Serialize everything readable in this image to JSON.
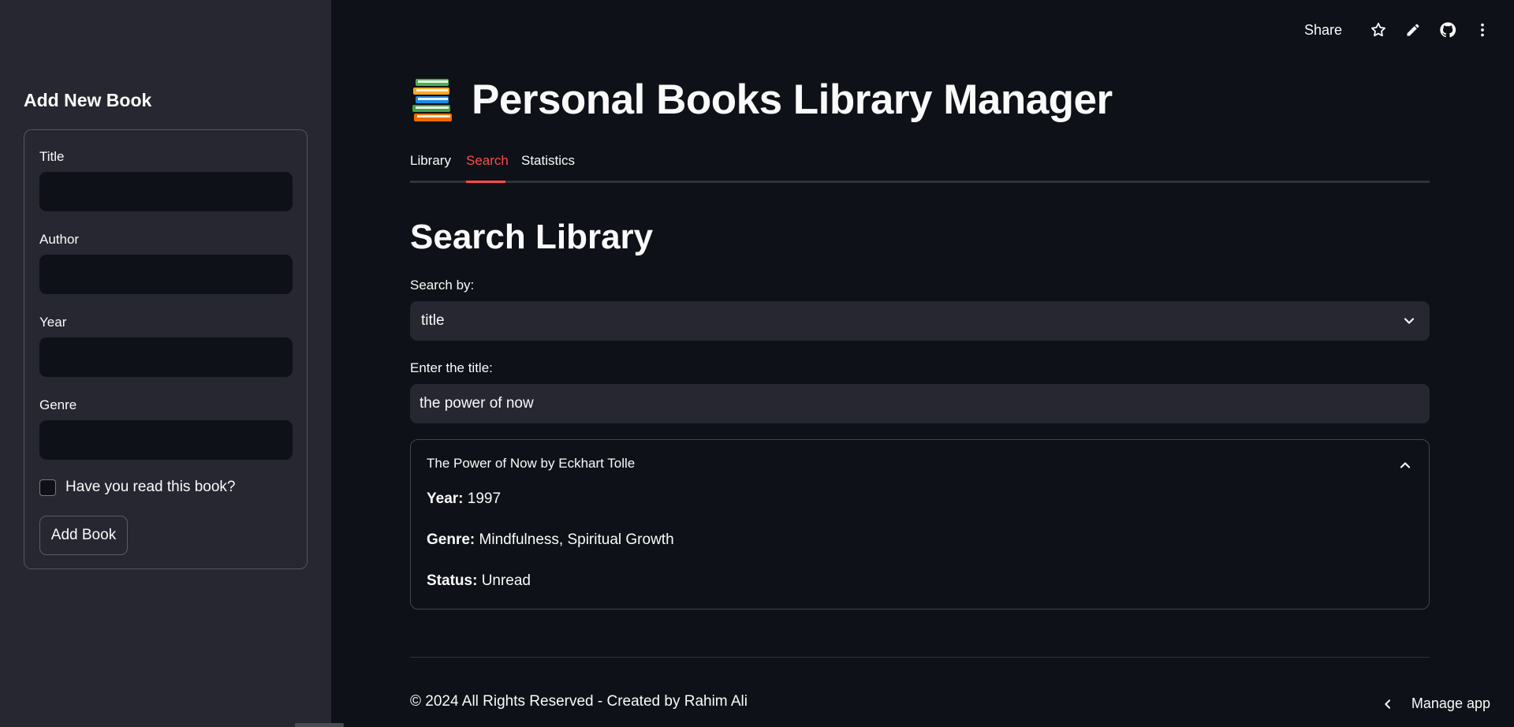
{
  "sidebar": {
    "title": "Add New Book",
    "fields": [
      {
        "label": "Title",
        "value": ""
      },
      {
        "label": "Author",
        "value": ""
      },
      {
        "label": "Year",
        "value": ""
      },
      {
        "label": "Genre",
        "value": ""
      }
    ],
    "read_checkbox": {
      "label": "Have you read this book?",
      "checked": false
    },
    "add_button": "Add Book"
  },
  "toolbar": {
    "share": "Share",
    "icons": [
      "star-icon",
      "pencil-icon",
      "github-icon",
      "more-vertical-icon"
    ]
  },
  "main": {
    "title": "Personal Books Library Manager",
    "title_icon": "books-icon",
    "tabs": [
      {
        "label": "Library",
        "active": false
      },
      {
        "label": "Search",
        "active": true
      },
      {
        "label": "Statistics",
        "active": false
      }
    ],
    "section_title": "Search Library",
    "search_by_label": "Search by:",
    "search_by_value": "title",
    "query_label": "Enter the title:",
    "query_value": "the power of now",
    "result": {
      "header": "The Power of Now by Eckhart Tolle",
      "year_label": "Year:",
      "year": "1997",
      "genre_label": "Genre:",
      "genre": "Mindfulness, Spiritual Growth",
      "status_label": "Status:",
      "status": "Unread"
    },
    "footer": "© 2024 All Rights Reserved - Created by Rahim Ali"
  },
  "manage_app": "Manage app",
  "colors": {
    "background": "#0e1117",
    "sidebar": "#262730",
    "accent": "#ff4b4b",
    "text": "#fafafa"
  }
}
